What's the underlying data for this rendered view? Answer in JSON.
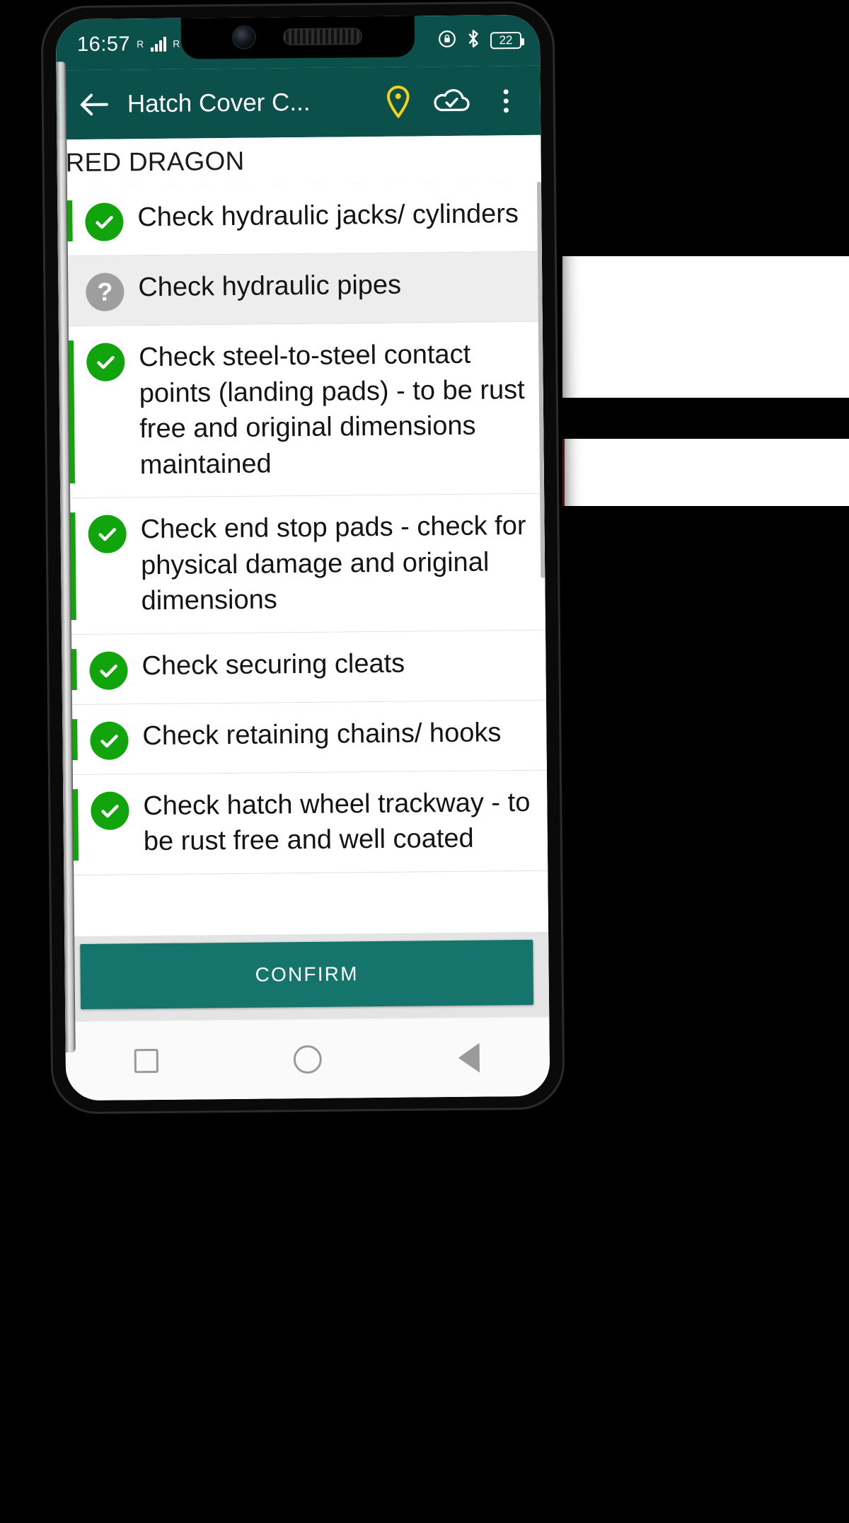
{
  "statusbar": {
    "time": "16:57",
    "sim1_label": "R",
    "sim2_label": "R",
    "wifi_icon": "wifi-icon",
    "lock_icon": "screen-lock-rotation-icon",
    "bluetooth_icon": "bluetooth-icon",
    "battery_level": "22"
  },
  "appbar": {
    "back_icon": "back-arrow-icon",
    "title": "Hatch Cover C...",
    "pin_icon": "location-pin-icon",
    "cloud_icon": "cloud-done-icon",
    "overflow_icon": "more-vertical-icon"
  },
  "vessel": {
    "name": "RED DRAGON"
  },
  "checklist": {
    "items": [
      {
        "status": "ok",
        "status_icon": "check-circle-icon",
        "text": "Check hydraulic jacks/ cylinders"
      },
      {
        "status": "unknown",
        "status_icon": "question-circle-icon",
        "text": "Check hydraulic pipes"
      },
      {
        "status": "ok",
        "status_icon": "check-circle-icon",
        "text": "Check steel-to-steel contact points (landing pads) - to be rust free and original dimensions maintained"
      },
      {
        "status": "ok",
        "status_icon": "check-circle-icon",
        "text": "Check end stop pads - check for physical damage and original dimensions"
      },
      {
        "status": "ok",
        "status_icon": "check-circle-icon",
        "text": "Check securing cleats"
      },
      {
        "status": "ok",
        "status_icon": "check-circle-icon",
        "text": "Check retaining chains/ hooks"
      },
      {
        "status": "ok",
        "status_icon": "check-circle-icon",
        "text": "Check hatch wheel trackway - to be rust free and well coated"
      }
    ],
    "unknown_glyph": "?"
  },
  "footer": {
    "confirm_label": "CONFIRM"
  },
  "navbar": {
    "recents_icon": "square-recents-icon",
    "home_icon": "circle-home-icon",
    "back_icon": "triangle-back-icon"
  },
  "colors": {
    "appbar": "#0b504a",
    "accent_green": "#11a40d",
    "confirm": "#15756c",
    "unknown_gray": "#9e9e9e",
    "pin_yellow": "#f2d11a"
  }
}
